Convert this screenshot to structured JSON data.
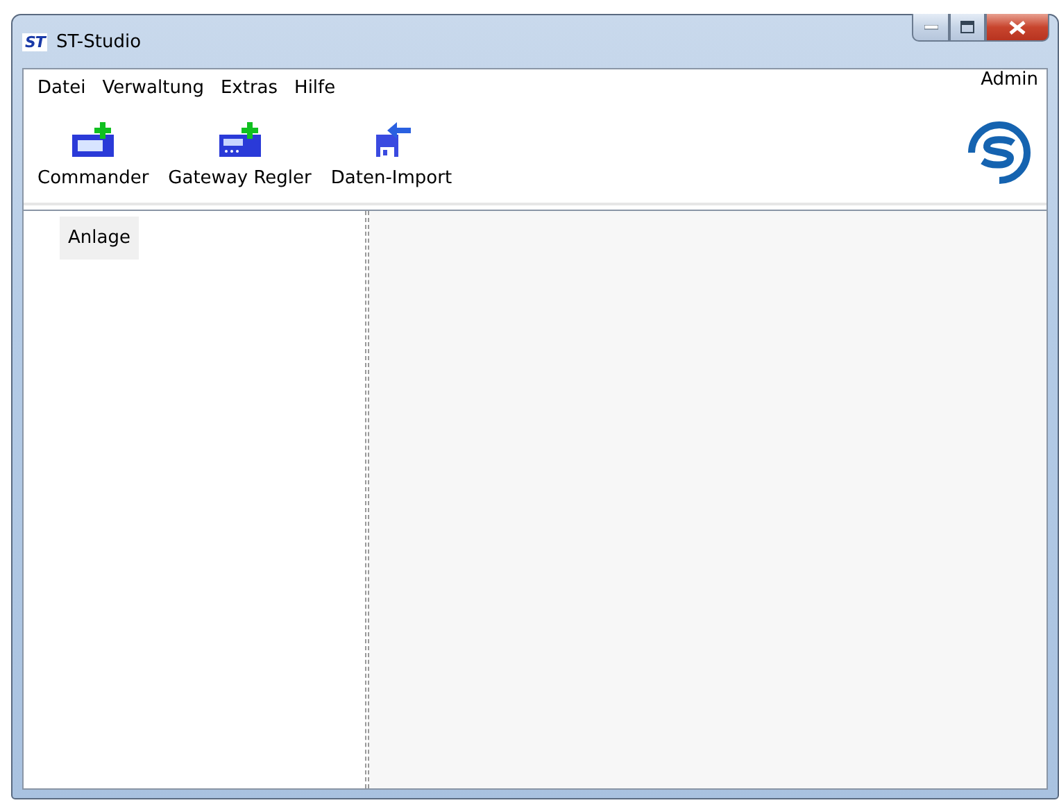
{
  "window": {
    "title": "ST-Studio",
    "app_icon": "ST"
  },
  "menu": [
    {
      "label": "Datei"
    },
    {
      "label": "Verwaltung"
    },
    {
      "label": "Extras"
    },
    {
      "label": "Hilfe"
    }
  ],
  "user": "Admin",
  "toolbar": [
    {
      "label": "Commander",
      "kind": "commander"
    },
    {
      "label": "Gateway Regler",
      "kind": "gateway"
    },
    {
      "label": "Daten-Import",
      "kind": "import"
    }
  ],
  "tree": [
    {
      "label": "Anlage",
      "selected": true
    }
  ]
}
